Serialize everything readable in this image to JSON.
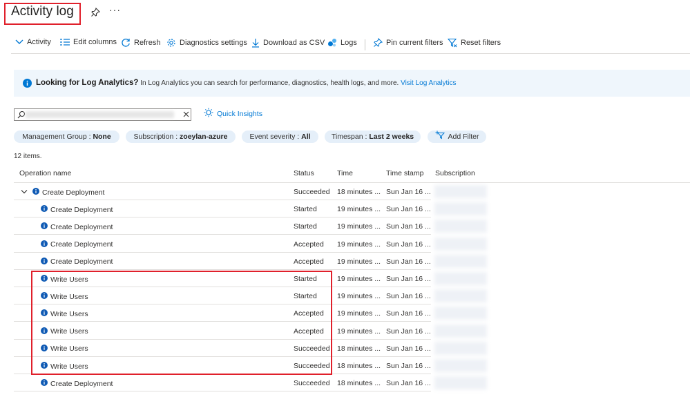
{
  "header": {
    "title": "Activity log"
  },
  "toolbar": {
    "activity": "Activity",
    "edit_columns": "Edit columns",
    "refresh": "Refresh",
    "diagnostics": "Diagnostics settings",
    "download_csv": "Download as CSV",
    "logs": "Logs",
    "pin_filters": "Pin current filters",
    "reset_filters": "Reset filters"
  },
  "banner": {
    "bold": "Looking for Log Analytics?",
    "text": " In Log Analytics you can search for performance, diagnostics, health logs, and more. ",
    "link": "Visit Log Analytics"
  },
  "search": {
    "value": ""
  },
  "quick_insights": "Quick Insights",
  "filters": [
    {
      "label": "Management Group : ",
      "value": "None"
    },
    {
      "label": "Subscription : ",
      "value": "zoeylan-azure"
    },
    {
      "label": "Event severity : ",
      "value": "All"
    },
    {
      "label": "Timespan : ",
      "value": "Last 2 weeks"
    }
  ],
  "add_filter": "Add Filter",
  "items_count": "12 items.",
  "columns": {
    "operation": "Operation name",
    "status": "Status",
    "time": "Time",
    "timestamp": "Sun Jan 16 ...",
    "timestamp_header": "Time stamp",
    "subscription": "Subscription"
  },
  "rows": [
    {
      "operation": "Create Deployment",
      "status": "Succeeded",
      "time": "18 minutes ...",
      "timestamp": "Sun Jan 16 ..."
    },
    {
      "operation": "Create Deployment",
      "status": "Started",
      "time": "19 minutes ...",
      "timestamp": "Sun Jan 16 ..."
    },
    {
      "operation": "Create Deployment",
      "status": "Started",
      "time": "19 minutes ...",
      "timestamp": "Sun Jan 16 ..."
    },
    {
      "operation": "Create Deployment",
      "status": "Accepted",
      "time": "19 minutes ...",
      "timestamp": "Sun Jan 16 ..."
    },
    {
      "operation": "Create Deployment",
      "status": "Accepted",
      "time": "19 minutes ...",
      "timestamp": "Sun Jan 16 ..."
    },
    {
      "operation": "Write Users",
      "status": "Started",
      "time": "19 minutes ...",
      "timestamp": "Sun Jan 16 ..."
    },
    {
      "operation": "Write Users",
      "status": "Started",
      "time": "19 minutes ...",
      "timestamp": "Sun Jan 16 ..."
    },
    {
      "operation": "Write Users",
      "status": "Accepted",
      "time": "19 minutes ...",
      "timestamp": "Sun Jan 16 ..."
    },
    {
      "operation": "Write Users",
      "status": "Accepted",
      "time": "19 minutes ...",
      "timestamp": "Sun Jan 16 ..."
    },
    {
      "operation": "Write Users",
      "status": "Succeeded",
      "time": "18 minutes ...",
      "timestamp": "Sun Jan 16 ..."
    },
    {
      "operation": "Write Users",
      "status": "Succeeded",
      "time": "18 minutes ...",
      "timestamp": "Sun Jan 16 ..."
    },
    {
      "operation": "Create Deployment",
      "status": "Succeeded",
      "time": "18 minutes ...",
      "timestamp": "Sun Jan 16 ..."
    }
  ],
  "colors": {
    "accent": "#0078d4",
    "highlight": "#e0202b",
    "pill_bg": "#e5eff9",
    "banner_bg": "#eff6fc"
  }
}
